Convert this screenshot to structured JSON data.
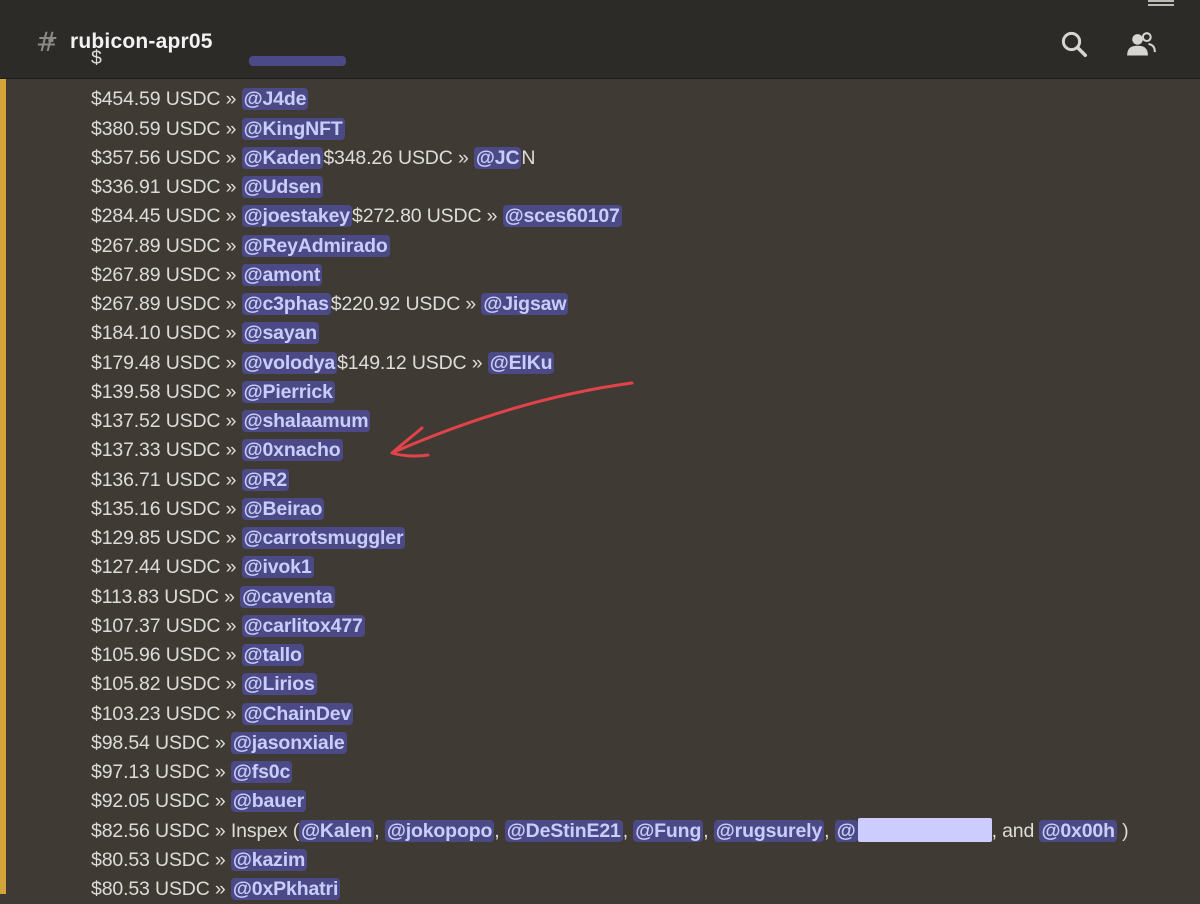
{
  "header": {
    "channel_icon": "hashtag-lock-icon",
    "channel_name": "rubicon-apr05",
    "search_icon": "search-icon",
    "members_icon": "members-icon"
  },
  "colors": {
    "background": "#3f3b34",
    "header": "#2d2b28",
    "mention_bg": "#4b4a86",
    "mention_text": "#c9cdfb",
    "highlight_bar": "#d3a43a",
    "annotation_arrow": "#e2424a"
  },
  "rows": [
    {
      "prefix": "",
      "mention": ""
    },
    {
      "prefix": "$454.59 USDC » ",
      "mention": "@J4de"
    },
    {
      "prefix": "$380.59 USDC » ",
      "mention": "@KingNFT"
    },
    {
      "prefix": "$357.56 USDC » ",
      "mention": "@Kaden",
      "mid": "$348.26 USDC » ",
      "mention2": "@JC",
      "suffix": "N"
    },
    {
      "prefix": "$336.91 USDC » ",
      "mention": "@Udsen"
    },
    {
      "prefix": "$284.45 USDC » ",
      "mention": "@joestakey",
      "mid": "$272.80 USDC » ",
      "mention2": "@sces60107"
    },
    {
      "prefix": "$267.89 USDC » ",
      "mention": "@ReyAdmirado"
    },
    {
      "prefix": "$267.89 USDC » ",
      "mention": "@amont"
    },
    {
      "prefix": "$267.89 USDC » ",
      "mention": "@c3phas",
      "mid": "$220.92 USDC » ",
      "mention2": "@Jigsaw"
    },
    {
      "prefix": "$184.10 USDC » ",
      "mention": "@sayan"
    },
    {
      "prefix": "$179.48 USDC » ",
      "mention": "@volodya",
      "mid": "$149.12 USDC » ",
      "mention2": "@ElKu"
    },
    {
      "prefix": "$139.58 USDC » ",
      "mention": "@Pierrick"
    },
    {
      "prefix": "$137.52 USDC » ",
      "mention": "@shalaamum"
    },
    {
      "prefix": "$137.33 USDC » ",
      "mention": "@0xnacho"
    },
    {
      "prefix": "$136.71 USDC » ",
      "mention": "@R2"
    },
    {
      "prefix": "$135.16 USDC » ",
      "mention": "@Beirao"
    },
    {
      "prefix": "$129.85 USDC » ",
      "mention": "@carrotsmuggler"
    },
    {
      "prefix": "$127.44 USDC » ",
      "mention": "@ivok1"
    },
    {
      "prefix": "$113.83 USDC » ",
      "mention": "@caventa"
    },
    {
      "prefix": "$107.37 USDC » ",
      "mention": "@carlitox477"
    },
    {
      "prefix": "$105.96 USDC » ",
      "mention": "@tallo"
    },
    {
      "prefix": "$105.82 USDC » ",
      "mention": "@Lirios"
    },
    {
      "prefix": "$103.23 USDC » ",
      "mention": "@ChainDev"
    },
    {
      "prefix": "$98.54 USDC » ",
      "mention": "@jasonxiale"
    },
    {
      "prefix": "$97.13 USDC » ",
      "mention": "@fs0c"
    },
    {
      "prefix": "$92.05 USDC » ",
      "mention": "@bauer"
    },
    {
      "prefix": "$82.56 USDC » Inspex (",
      "team": [
        "@Kalen",
        "@jokopopo",
        "@DeStinE21",
        "@Fung",
        "@rugsurely",
        "@"
      ],
      "and_text": ", and ",
      "last": "@0x00h",
      "close": " )"
    },
    {
      "prefix": "$80.53 USDC » ",
      "mention": "@kazim"
    },
    {
      "prefix": "$80.53 USDC » ",
      "mention": "@0xPkhatri"
    }
  ]
}
